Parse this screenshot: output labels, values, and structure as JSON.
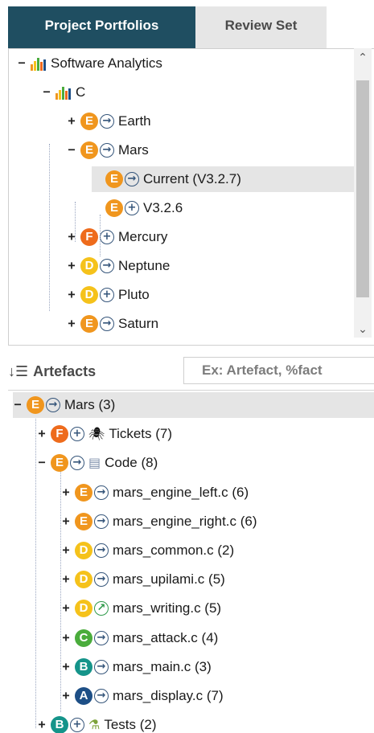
{
  "tabs": [
    {
      "label": "Project Portfolios",
      "active": true
    },
    {
      "label": "Review Set",
      "active": false
    }
  ],
  "portfolio_tree": [
    {
      "label": "Software Analytics",
      "level": 0,
      "expander": "−",
      "icon": "bar-chart-icon"
    },
    {
      "label": "C",
      "level": 1,
      "expander": "−",
      "icon": "bar-chart-icon"
    },
    {
      "label": "Earth",
      "level": 2,
      "expander": "+",
      "rating": "E",
      "trend": "→"
    },
    {
      "label": "Mars",
      "level": 2,
      "expander": "−",
      "rating": "E",
      "trend": "→"
    },
    {
      "label": "Current (V3.2.7)",
      "level": 3,
      "expander": "",
      "rating": "E",
      "trend": "→",
      "selected": true
    },
    {
      "label": "V3.2.6",
      "level": 3,
      "expander": "",
      "rating": "E",
      "trend": "+"
    },
    {
      "label": "Mercury",
      "level": 2,
      "expander": "+",
      "rating": "F",
      "trend": "+"
    },
    {
      "label": "Neptune",
      "level": 2,
      "expander": "+",
      "rating": "D",
      "trend": "→"
    },
    {
      "label": "Pluto",
      "level": 2,
      "expander": "+",
      "rating": "D",
      "trend": "+"
    },
    {
      "label": "Saturn",
      "level": 2,
      "expander": "+",
      "rating": "E",
      "trend": "→"
    }
  ],
  "artefacts": {
    "title": "Artefacts",
    "search_placeholder": "Ex: Artefact, %fact",
    "tree": [
      {
        "label": "Mars (3)",
        "level": 0,
        "expander": "−",
        "rating": "E",
        "trend": "→",
        "selected": true
      },
      {
        "label": "Tickets (7)",
        "level": 1,
        "expander": "+",
        "rating": "F",
        "trend": "+",
        "icon": "bug-icon"
      },
      {
        "label": "Code (8)",
        "level": 1,
        "expander": "−",
        "rating": "E",
        "trend": "→",
        "icon": "file-icon"
      },
      {
        "label": "mars_engine_left.c (6)",
        "level": 2,
        "expander": "+",
        "rating": "E",
        "trend": "→"
      },
      {
        "label": "mars_engine_right.c (6)",
        "level": 2,
        "expander": "+",
        "rating": "E",
        "trend": "→"
      },
      {
        "label": "mars_common.c (2)",
        "level": 2,
        "expander": "+",
        "rating": "D",
        "trend": "→"
      },
      {
        "label": "mars_upilami.c (5)",
        "level": 2,
        "expander": "+",
        "rating": "D",
        "trend": "→"
      },
      {
        "label": "mars_writing.c (5)",
        "level": 2,
        "expander": "+",
        "rating": "D",
        "trend": "↗"
      },
      {
        "label": "mars_attack.c (4)",
        "level": 2,
        "expander": "+",
        "rating": "C",
        "trend": "→"
      },
      {
        "label": "mars_main.c (3)",
        "level": 2,
        "expander": "+",
        "rating": "B",
        "trend": "→"
      },
      {
        "label": "mars_display.c (7)",
        "level": 2,
        "expander": "+",
        "rating": "A",
        "trend": "→"
      },
      {
        "label": "Tests (2)",
        "level": 1,
        "expander": "+",
        "rating": "B",
        "trend": "+",
        "icon": "flask-icon"
      }
    ]
  },
  "rating_colors": {
    "A": "#1d4f86",
    "B": "#15948a",
    "C": "#4aac3c",
    "D": "#f5c21b",
    "E": "#f0961e",
    "F": "#ee6b1c"
  }
}
